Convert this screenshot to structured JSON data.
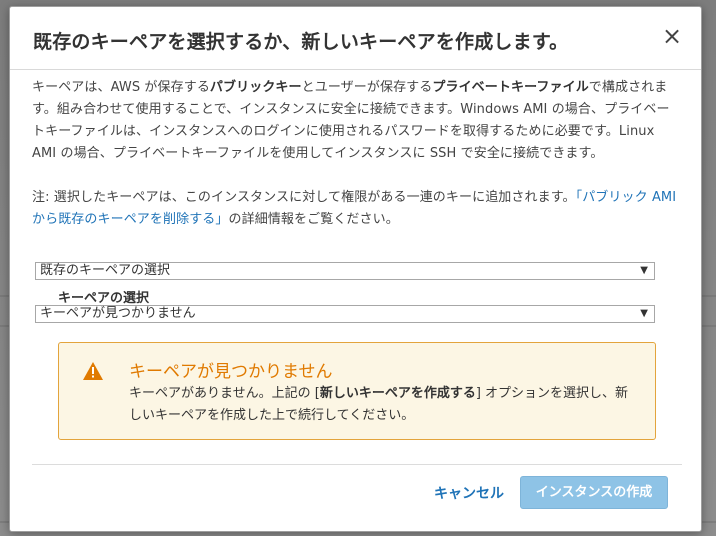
{
  "dialog": {
    "title": "既存のキーペアを選択するか、新しいキーペアを作成します。",
    "close_label": "×"
  },
  "intro": {
    "t1": "キーペアは、AWS が保存する",
    "b1": "パブリックキー",
    "t2": "とユーザーが保存する",
    "b2": "プライベートキーファイル",
    "t3": "で構成されます。組み合わせて使用することで、インスタンスに安全に接続できます。Windows AMI の場合、プライベートキーファイルは、インスタンスへのログインに使用されるパスワードを取得するために必要です。Linux AMI の場合、プライベートキーファイルを使用してインスタンスに SSH で安全に接続できます。"
  },
  "note": {
    "t1": "注: 選択したキーペアは、このインスタンスに対して権限がある一連のキーに追加されます。",
    "link": "「パブリック AMI から既存のキーペアを削除する」",
    "t2": "の詳細情報をご覧ください。"
  },
  "form": {
    "mode_select_value": "既存のキーペアの選択",
    "keypair_label": "キーペアの選択",
    "keypair_select_value": "キーペアが見つかりません"
  },
  "alert": {
    "icon": "warning-icon",
    "title": "キーペアが見つかりません",
    "t1": "キーペアがありません。上記の [",
    "b1": "新しいキーペアを作成する",
    "t2": "] オプションを選択し、新しいキーペアを作成した上で続行してください。",
    "color_border": "#e3a43c",
    "color_title": "#e07a00"
  },
  "footer": {
    "cancel_label": "キャンセル",
    "create_label": "インスタンスの作成"
  }
}
